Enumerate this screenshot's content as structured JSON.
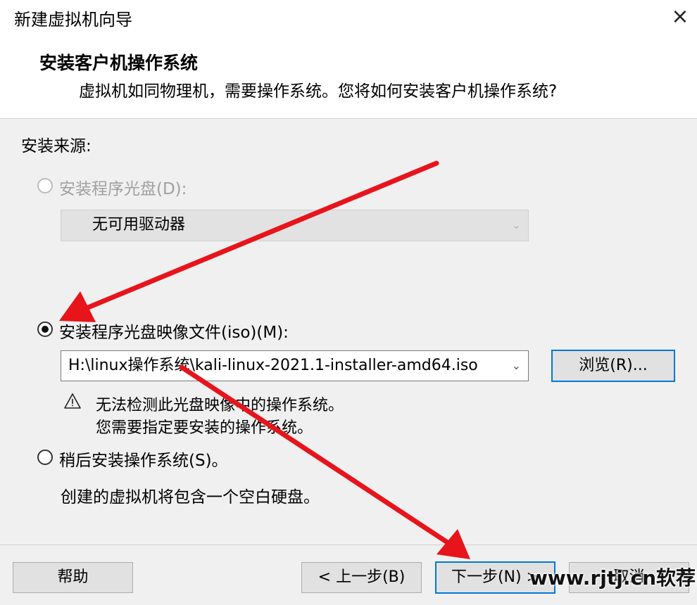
{
  "window": {
    "title": "新建虚拟机向导",
    "close_icon": "×"
  },
  "header": {
    "title": "安装客户机操作系统",
    "subtitle": "虚拟机如同物理机，需要操作系统。您将如何安装客户机操作系统?"
  },
  "source": {
    "label": "安装来源:",
    "disc_option": {
      "label": "安装程序光盘(D):",
      "selected": false,
      "enabled": false,
      "drive_value": "无可用驱动器"
    },
    "iso_option": {
      "label": "安装程序光盘映像文件(iso)(M):",
      "selected": true,
      "path_value": "H:\\linux操作系统\\kali-linux-2021.1-installer-amd64.iso",
      "browse_label": "浏览(R)..."
    },
    "warning": {
      "line1": "无法检测此光盘映像中的操作系统。",
      "line2": "您需要指定要安装的操作系统。"
    },
    "later_option": {
      "label": "稍后安装操作系统(S)。",
      "selected": false,
      "description": "创建的虚拟机将包含一个空白硬盘。"
    }
  },
  "footer": {
    "help_label": "帮助",
    "back_label": "< 上一步(B)",
    "next_label": "下一步(N) >",
    "cancel_label": "取消"
  },
  "watermark": "www.rjtj.cn软荐网",
  "colors": {
    "annotation_arrow": "#e8141b",
    "default_button_border": "#0078d7"
  }
}
